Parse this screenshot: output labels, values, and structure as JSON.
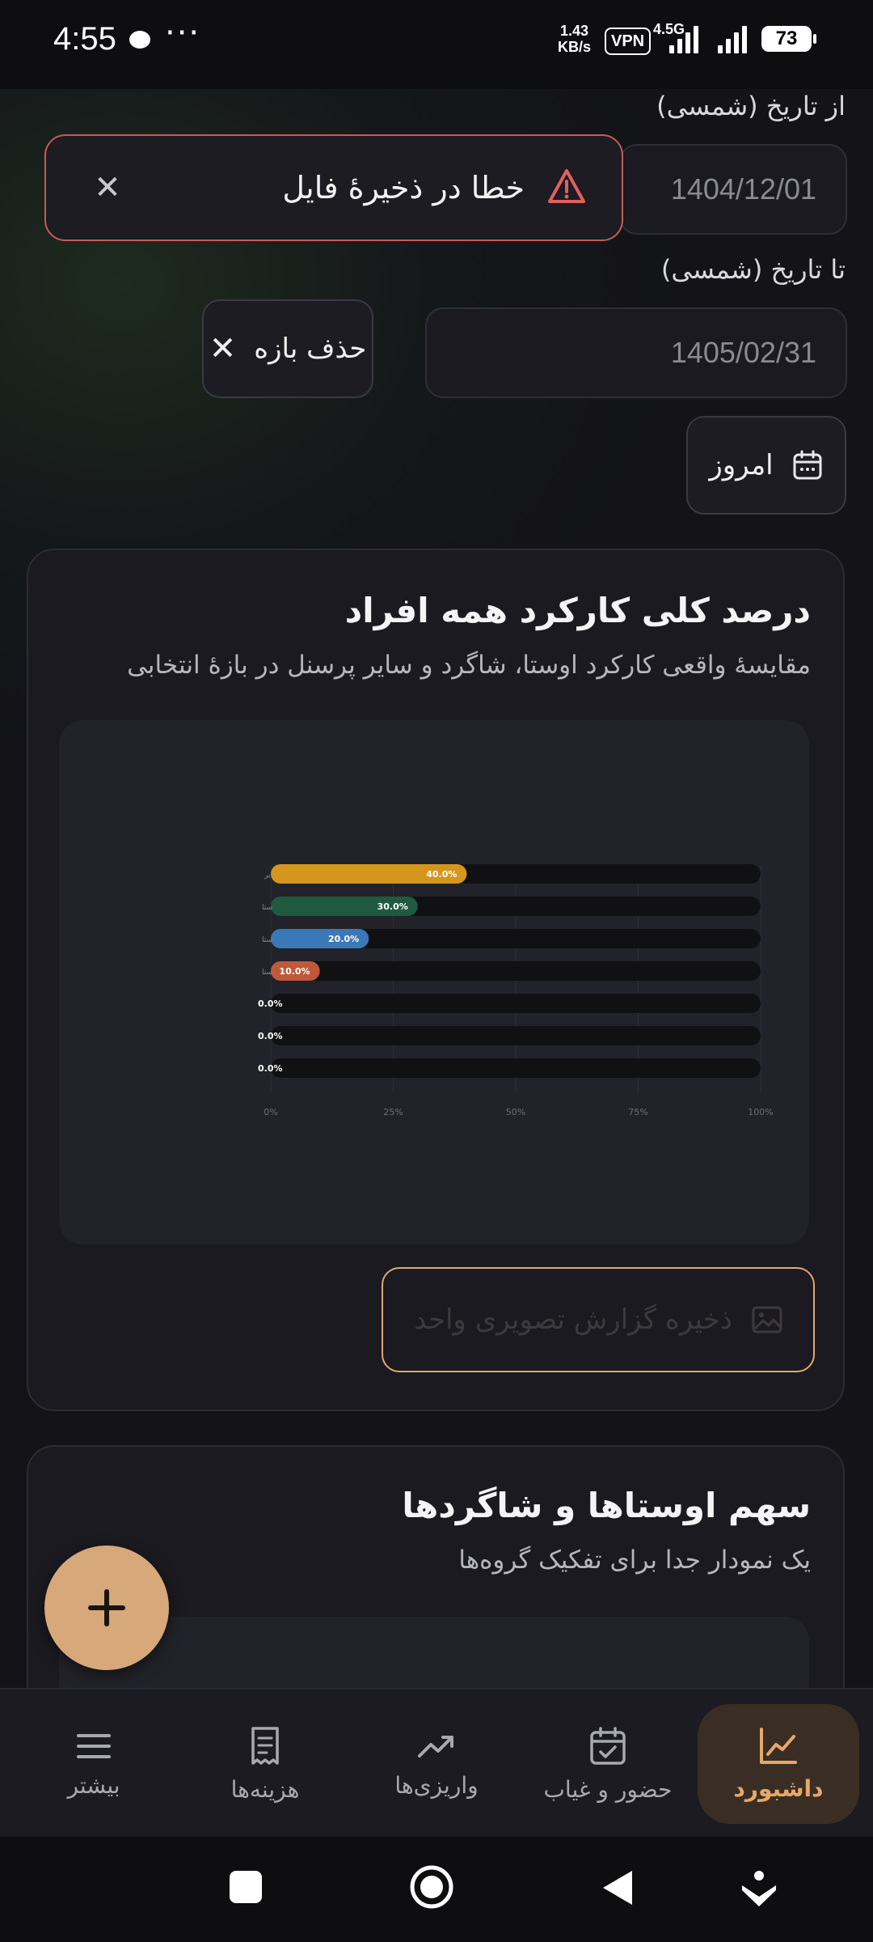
{
  "status_bar": {
    "time": "4:55",
    "speed_value": "1.43",
    "speed_unit": "KB/s",
    "vpn": "VPN",
    "network": "4.5G",
    "battery": "73"
  },
  "filters": {
    "from_label": "از تاریخ (شمسی)",
    "from_value": "1404/12/01",
    "to_label": "تا تاریخ (شمسی)",
    "to_value": "1405/02/31",
    "clear_range_label": "حذف بازه",
    "today_label": "امروز"
  },
  "toast": {
    "message": "خطا در ذخیرهٔ فایل",
    "icon": "warning-icon",
    "color": "#e06060"
  },
  "card_overall": {
    "title": "درصد کلی کارکرد همه افراد",
    "subtitle": "مقایسهٔ واقعی کارکرد اوستا، شاگرد و سایر پرسنل در بازهٔ انتخابی",
    "save_button_label": "ذخیره گزارش تصویری واحد"
  },
  "chart_data": {
    "type": "bar",
    "orientation": "horizontal",
    "categories": [
      "ایر",
      "ستا",
      "ستا",
      "ستا",
      "",
      "",
      ""
    ],
    "values": [
      40.0,
      30.0,
      20.0,
      10.0,
      0.0,
      0.0,
      0.0
    ],
    "value_labels": [
      "40.0%",
      "30.0%",
      "20.0%",
      "10.0%",
      "0.0%",
      "0.0%",
      "0.0%"
    ],
    "colors": [
      "#d4961c",
      "#1f5a40",
      "#3a78b8",
      "#c0583a",
      "#555555",
      "#555555",
      "#555555"
    ],
    "xlim": [
      0,
      100
    ],
    "x_ticks": [
      "0%",
      "25%",
      "50%",
      "75%",
      "100%"
    ],
    "grid": true
  },
  "card_share": {
    "title": "سهم اوستاها و شاگردها",
    "subtitle": "یک نمودار جدا برای تفکیک گروه‌ها"
  },
  "fab": {
    "icon": "plus-icon"
  },
  "bottom_nav": {
    "items": [
      {
        "label": "بیشتر",
        "icon": "menu-icon"
      },
      {
        "label": "هزینه‌ها",
        "icon": "receipt-icon"
      },
      {
        "label": "واریزی‌ها",
        "icon": "trend-icon"
      },
      {
        "label": "حضور و غیاب",
        "icon": "calendar-check-icon"
      },
      {
        "label": "داشبورد",
        "icon": "chart-icon",
        "active": true
      }
    ]
  }
}
